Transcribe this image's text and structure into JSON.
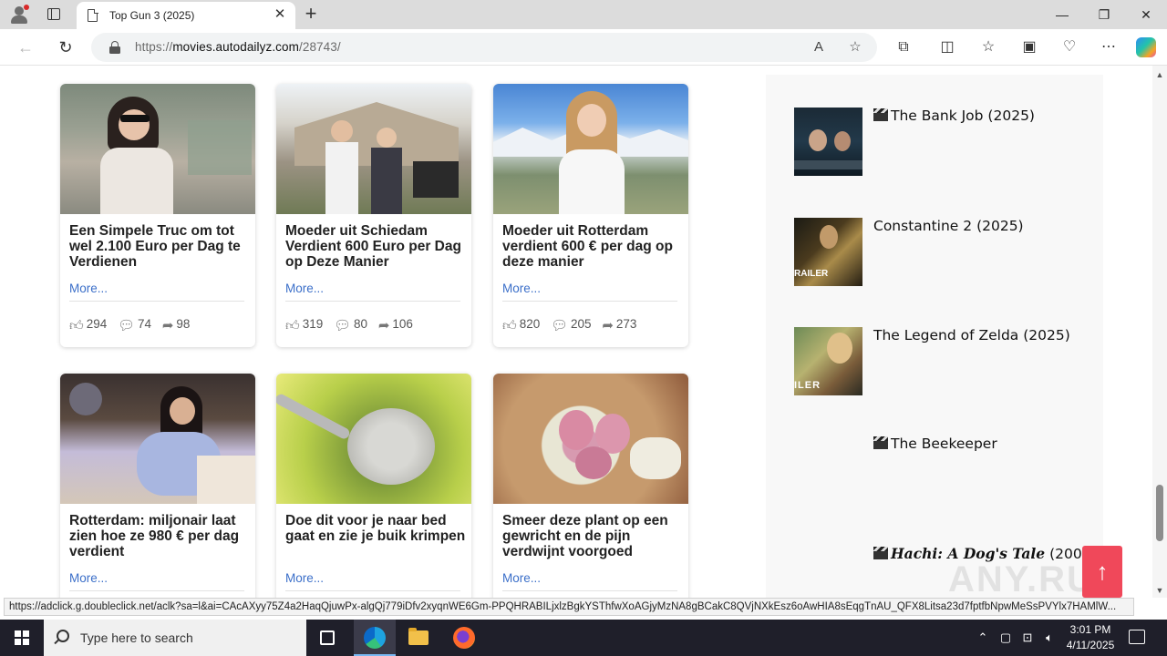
{
  "browser": {
    "tab_title": "Top Gun 3 (2025)",
    "tab_close": "✕",
    "new_tab": "+",
    "url_prefix": "https://",
    "url_host": "movies.autodailyz.com",
    "url_path": "/28743/",
    "window_controls": {
      "minimize": "—",
      "maximize": "❐",
      "close": "✕"
    },
    "status_link": "https://adclick.g.doubleclick.net/aclk?sa=l&ai=CAcAXyy75Z4a2HaqQjuwPx-algQj779iDfv2xyqnWE6Gm-PPQHRABILjxlzBgkYSThfwXoAGjyMzNA8gBCakC8QVjNXkEsz6oAwHIA8sEqgTnAU_QFX8Litsa23d7fptfbNpwMeSsPVYlx7HAMlW..."
  },
  "articles": [
    {
      "headline": "Een Simpele Truc om tot wel 2.100 Euro per Dag te Verdienen",
      "more": "More...",
      "likes": "294",
      "comments": "74",
      "shares": "98",
      "thumb": "woman-sunglasses"
    },
    {
      "headline": "Moeder uit Schiedam Verdient 600 Euro per Dag op Deze Manier",
      "more": "More...",
      "likes": "319",
      "comments": "80",
      "shares": "106",
      "thumb": "family-house"
    },
    {
      "headline": "Moeder uit Rotterdam verdient 600 € per dag op deze manier",
      "more": "More...",
      "likes": "820",
      "comments": "205",
      "shares": "273",
      "thumb": "woman-mountains"
    },
    {
      "headline": "Rotterdam: miljonair laat zien hoe ze 980 € per dag verdient",
      "more": "More...",
      "thumb": "woman-city"
    },
    {
      "headline": "Doe dit voor je naar bed gaat en zie je buik krimpen",
      "more": "More...",
      "thumb": "spoon-seeds"
    },
    {
      "headline": "Smeer deze plant op een gewricht en de pijn verdwijnt voorgoed",
      "more": "More...",
      "thumb": "plant-fruit"
    }
  ],
  "sidebar": {
    "items": [
      {
        "title": "The Bank Job (2025)",
        "clapper": true,
        "thumb": "bank-job-poster"
      },
      {
        "title": "Constantine 2 (2025)",
        "clapper": false,
        "thumb": "constantine-poster",
        "thumb_text": "RAILER"
      },
      {
        "title": "The Legend of Zelda (2025)",
        "clapper": false,
        "thumb": "zelda-poster",
        "thumb_text": "ILER"
      },
      {
        "title": "The Beekeeper",
        "clapper": true
      },
      {
        "title": "Hachi: A Dog's Tale",
        "title_suffix": " (2009)",
        "clapper": true
      }
    ]
  },
  "watermark": "ANY.RUN",
  "scroll_top_icon": "arrow-up-icon",
  "taskbar": {
    "search_placeholder": "Type here to search",
    "time": "3:01 PM",
    "date": "4/11/2025"
  },
  "colors": {
    "accent_link": "#3b6fc9",
    "scroll_top": "#f0485a",
    "taskbar": "#1f1f2a"
  }
}
